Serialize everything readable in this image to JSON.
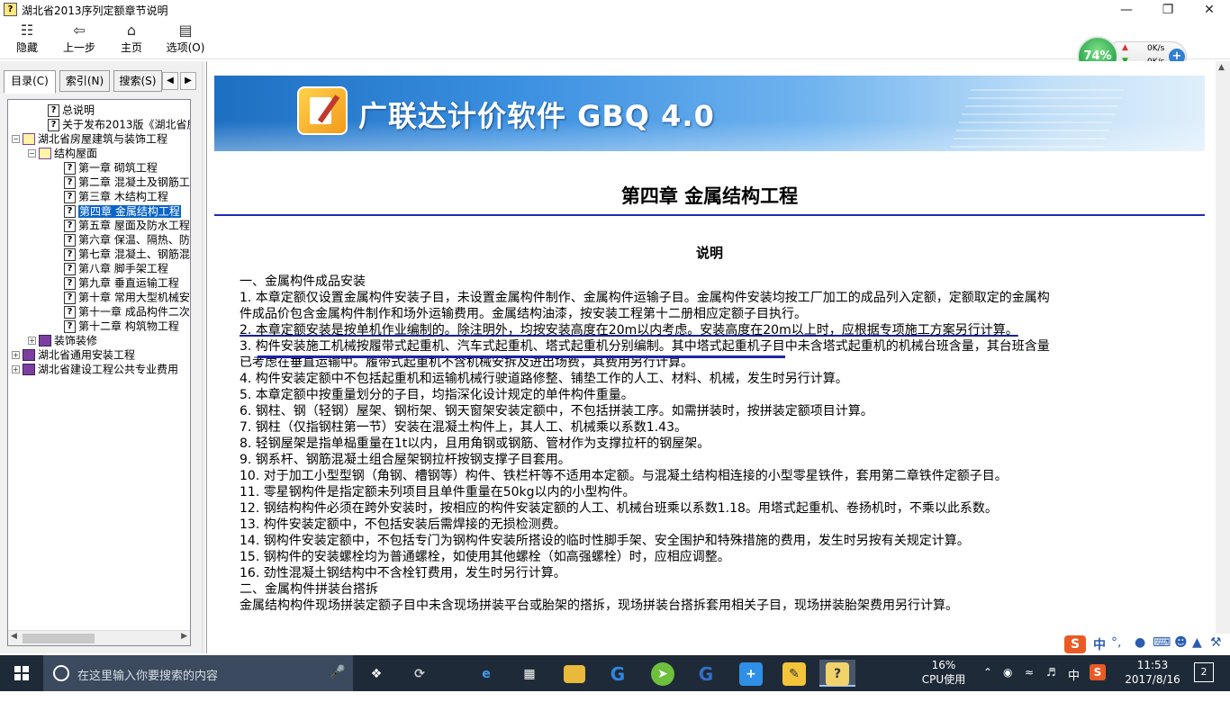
{
  "window": {
    "title": "湖北省2013序列定额章节说明",
    "app_icon": "help-book-icon",
    "minimize": "—",
    "restore": "❐",
    "close": "✕"
  },
  "toolbar": {
    "hide": "隐藏",
    "back": "上一步",
    "home": "主页",
    "options": "选项(O)"
  },
  "net_widget": {
    "percent": "74%",
    "up": "0K/s",
    "down": "0K/s"
  },
  "tabs": {
    "contents": "目录(C)",
    "index": "索引(N)",
    "search": "搜索(S)"
  },
  "tree": [
    {
      "label": "总说明",
      "level": 1,
      "icon": "q"
    },
    {
      "label": "关于发布2013版《湖北省房屋",
      "level": 1,
      "icon": "q"
    },
    {
      "label": "湖北省房屋建筑与装饰工程",
      "level": 0,
      "icon": "book-open",
      "exp": "−"
    },
    {
      "label": "结构屋面",
      "level": 1,
      "icon": "book-open",
      "exp": "−"
    },
    {
      "label": "第一章  砌筑工程",
      "level": 2,
      "icon": "q"
    },
    {
      "label": "第二章  混凝土及钢筋工",
      "level": 2,
      "icon": "q"
    },
    {
      "label": "第三章  木结构工程",
      "level": 2,
      "icon": "q"
    },
    {
      "label": "第四章  金属结构工程",
      "level": 2,
      "icon": "q",
      "selected": true
    },
    {
      "label": "第五章  屋面及防水工程",
      "level": 2,
      "icon": "q"
    },
    {
      "label": "第六章  保温、隔热、防",
      "level": 2,
      "icon": "q"
    },
    {
      "label": "第七章  混凝土、钢筋混",
      "level": 2,
      "icon": "q"
    },
    {
      "label": "第八章  脚手架工程",
      "level": 2,
      "icon": "q"
    },
    {
      "label": "第九章  垂直运输工程",
      "level": 2,
      "icon": "q"
    },
    {
      "label": "第十章  常用大型机械安",
      "level": 2,
      "icon": "q"
    },
    {
      "label": "第十一章  成品构件二次",
      "level": 2,
      "icon": "q"
    },
    {
      "label": "第十二章  构筑物工程",
      "level": 2,
      "icon": "q"
    },
    {
      "label": "装饰装修",
      "level": 1,
      "icon": "book",
      "exp": "+"
    },
    {
      "label": "湖北省通用安装工程",
      "level": 0,
      "icon": "book",
      "exp": "+"
    },
    {
      "label": "湖北省建设工程公共专业费用",
      "level": 0,
      "icon": "book",
      "exp": "+"
    }
  ],
  "banner": {
    "title": "广联达计价软件 GBQ 4.0"
  },
  "doc": {
    "chapter": "第四章  金属结构工程",
    "section": "说明",
    "lines": [
      "一、金属构件成品安装",
      "1. 本章定额仅设置金属构件安装子目，未设置金属构件制作、金属构件运输子目。金属构件安装均按工厂加工的成品列入定额，定额取定的金属构",
      "件成品价包含金属构件制作和场外运输费用。金属结构油漆，按安装工程第十二册相应定额子目执行。",
      "2. 本章定额安装是按单机作业编制的。除注明外，均按安装高度在20m以内考虑。安装高度在20m以上时，应根据专项施工方案另行计算。",
      "3. 构件安装施工机械按履带式起重机、汽车式起重机、塔式起重机分别编制。其中塔式起重机子目中未含塔式起重机的机械台班含量，其台班含量",
      "已考虑在垂直运输中。履带式起重机不含机械安拆及进出场费，其费用另行计算。",
      "4. 构件安装定额中不包括起重机和运输机械行驶道路修整、铺垫工作的人工、材料、机械，发生时另行计算。",
      "5. 本章定额中按重量划分的子目，均指深化设计规定的单件构件重量。",
      "6. 钢柱、钢（轻钢）屋架、钢桁架、钢天窗架安装定额中，不包括拼装工序。如需拼装时，按拼装定额项目计算。",
      "7. 钢柱（仅指钢柱第一节）安装在混凝土构件上，其人工、机械乘以系数1.43。",
      "8. 轻钢屋架是指单榀重量在1t以内，且用角钢或钢筋、管材作为支撑拉杆的钢屋架。",
      "9. 钢系杆、钢筋混凝土组合屋架钢拉杆按钢支撑子目套用。",
      "10. 对于加工小型型钢（角钢、槽钢等）构件、铁栏杆等不适用本定额。与混凝土结构相连接的小型零星铁件，套用第二章铁件定额子目。",
      "11. 零星钢构件是指定额未列项目且单件重量在50kg以内的小型构件。",
      "12. 钢结构构件必须在跨外安装时，按相应的构件安装定额的人工、机械台班乘以系数1.18。用塔式起重机、卷扬机时，不乘以此系数。",
      "13. 构件安装定额中，不包括安装后需焊接的无损检测费。",
      "14. 钢构件安装定额中，不包括专门为钢构件安装所搭设的临时性脚手架、安全围护和特殊措施的费用，发生时另按有关规定计算。",
      "15. 钢构件的安装螺栓均为普通螺栓，如使用其他螺栓（如高强螺栓）时，应相应调整。",
      "16. 劲性混凝土钢结构中不含栓钉费用，发生时另行计算。",
      "二、金属构件拼装台搭拆",
      "金属结构构件现场拼装定额子目中未含现场拼装平台或胎架的搭拆，现场拼装台搭拆套用相关子目，现场拼装胎架费用另行计算。"
    ]
  },
  "taskbar": {
    "search_placeholder": "在这里输入你要搜索的内容",
    "cpu_percent": "16%",
    "cpu_label": "CPU使用",
    "ime_lang": "中",
    "time": "11:53",
    "date": "2017/8/16",
    "notif_count": "2",
    "ime_bar_lang": "中"
  }
}
